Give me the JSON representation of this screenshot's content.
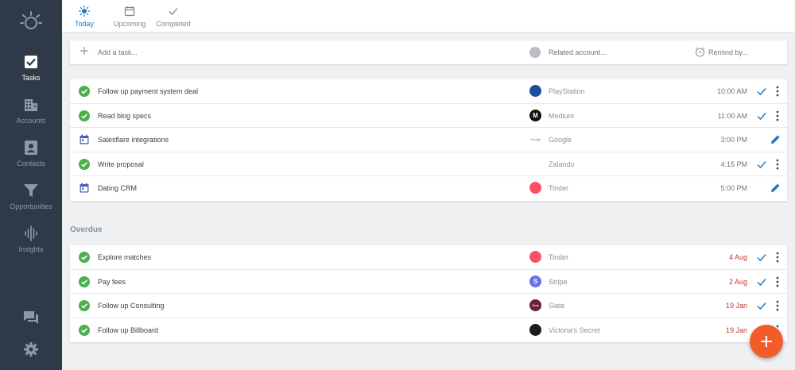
{
  "sidebar": {
    "items": [
      {
        "label": "Tasks",
        "icon": "checkbox-icon",
        "active": true
      },
      {
        "label": "Accounts",
        "icon": "building-icon",
        "active": false
      },
      {
        "label": "Contacts",
        "icon": "contact-card-icon",
        "active": false
      },
      {
        "label": "Opportunities",
        "icon": "funnel-icon",
        "active": false
      },
      {
        "label": "Insights",
        "icon": "waveform-icon",
        "active": false
      }
    ],
    "bottom": [
      "chat-icon",
      "gear-icon"
    ]
  },
  "tabs": [
    {
      "label": "Today",
      "icon": "sun-icon",
      "active": true
    },
    {
      "label": "Upcoming",
      "icon": "calendar-icon",
      "active": false
    },
    {
      "label": "Completed",
      "icon": "check-icon",
      "active": false
    }
  ],
  "add_task": {
    "placeholder": "Add a task...",
    "account_placeholder": "Related account...",
    "remind_placeholder": "Remind by..."
  },
  "today": [
    {
      "title": "Follow up payment system deal",
      "type": "done",
      "account": "PlayStation",
      "time": "10:00 AM"
    },
    {
      "title": "Read blog specs",
      "type": "done",
      "account": "Medium",
      "time": "11:00 AM"
    },
    {
      "title": "Salesflare integrations",
      "type": "meeting",
      "account": "Google",
      "time": "3:00 PM"
    },
    {
      "title": "Write proposal",
      "type": "done",
      "account": "Zalando",
      "time": "4:15 PM"
    },
    {
      "title": "Dating CRM",
      "type": "meeting",
      "account": "Tinder",
      "time": "5:00 PM"
    }
  ],
  "overdue_title": "Overdue",
  "overdue": [
    {
      "title": "Explore matches",
      "type": "done",
      "account": "Tinder",
      "time": "4 Aug"
    },
    {
      "title": "Pay fees",
      "type": "done",
      "account": "Stripe",
      "time": "2 Aug"
    },
    {
      "title": "Follow up Consulting",
      "type": "done",
      "account": "Slate",
      "time": "19 Jan"
    },
    {
      "title": "Follow up Billboard",
      "type": "done",
      "account": "Victoria's Secret",
      "time": "19 Jan"
    }
  ],
  "account_logos": {
    "PlayStation": {
      "bg": "#1a4f9c",
      "text": ""
    },
    "Medium": {
      "bg": "#111111",
      "text": "M"
    },
    "Google": {
      "bg": "#ffffff",
      "text": "Google"
    },
    "Zalando": {
      "bg": "#ffffff",
      "text": ""
    },
    "Tinder": {
      "bg": "#fd5068",
      "text": ""
    },
    "Stripe": {
      "bg": "#6772e5",
      "text": "S"
    },
    "Slate": {
      "bg": "#6b1e3e",
      "text": "Slate"
    },
    "Victoria's Secret": {
      "bg": "#1c1c1c",
      "text": ""
    }
  },
  "colors": {
    "accent": "#1f7ac7",
    "done": "#4caf50",
    "meeting": "#4a5bb8",
    "overdue": "#c0392b",
    "fab": "#f35b2a"
  }
}
